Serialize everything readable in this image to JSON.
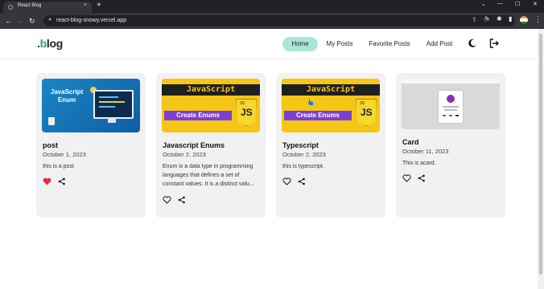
{
  "browser": {
    "tab_title": "React Blog",
    "tab_close": "×",
    "new_tab": "+",
    "url": "react-blog-snowy.vercel.app",
    "window_controls": [
      "⌄",
      "—",
      "☐",
      "✕"
    ],
    "icons": [
      "back-icon",
      "forward-icon",
      "reload-icon",
      "share-icon",
      "bookmark-star-icon",
      "pen-icon",
      "extensions-icon",
      "sidebar-icon",
      "profile-flag-icon",
      "menu-icon"
    ]
  },
  "site": {
    "logo_dot": ".",
    "logo_b": "b",
    "logo_rest": "log"
  },
  "nav": {
    "home": "Home",
    "my_posts": "My Posts",
    "favorite_posts": "Favorite Posts",
    "add_post": "Add Post",
    "theme_icon": "moon-icon",
    "logout_icon": "logout-icon",
    "active_color": "#a8e6d9"
  },
  "posts": [
    {
      "title": "post",
      "date": "October 1, 2023",
      "excerpt": "this is a post",
      "favorited": true,
      "thumb_text_1": "JavaScript",
      "thumb_text_2": "Enum"
    },
    {
      "title": "Javascript Enums",
      "date": "October 2, 2023",
      "excerpt_lines": [
        "Enum is a data type in programming",
        "languages that defines a set of",
        "constant values. It is a distinct valu..."
      ],
      "favorited": false,
      "thumb_heading": "JavaScript",
      "thumb_badge": "Create Enums",
      "thumb_logo": "JS",
      "thumb_logo_small": "JS"
    },
    {
      "title": "Typescript",
      "date": "October 2, 2023",
      "excerpt": "this is typescript.",
      "favorited": false,
      "thumb_heading": "JavaScript",
      "thumb_badge": "Create Enums",
      "thumb_logo": "JS",
      "thumb_logo_small": "JS"
    },
    {
      "title": "Card",
      "date": "October 11, 2023",
      "excerpt": "This is acard.",
      "favorited": false
    }
  ],
  "colors": {
    "heart_filled": "#e0303f",
    "card_bg": "#f1f1f4",
    "accent": "#2a9d8f"
  }
}
